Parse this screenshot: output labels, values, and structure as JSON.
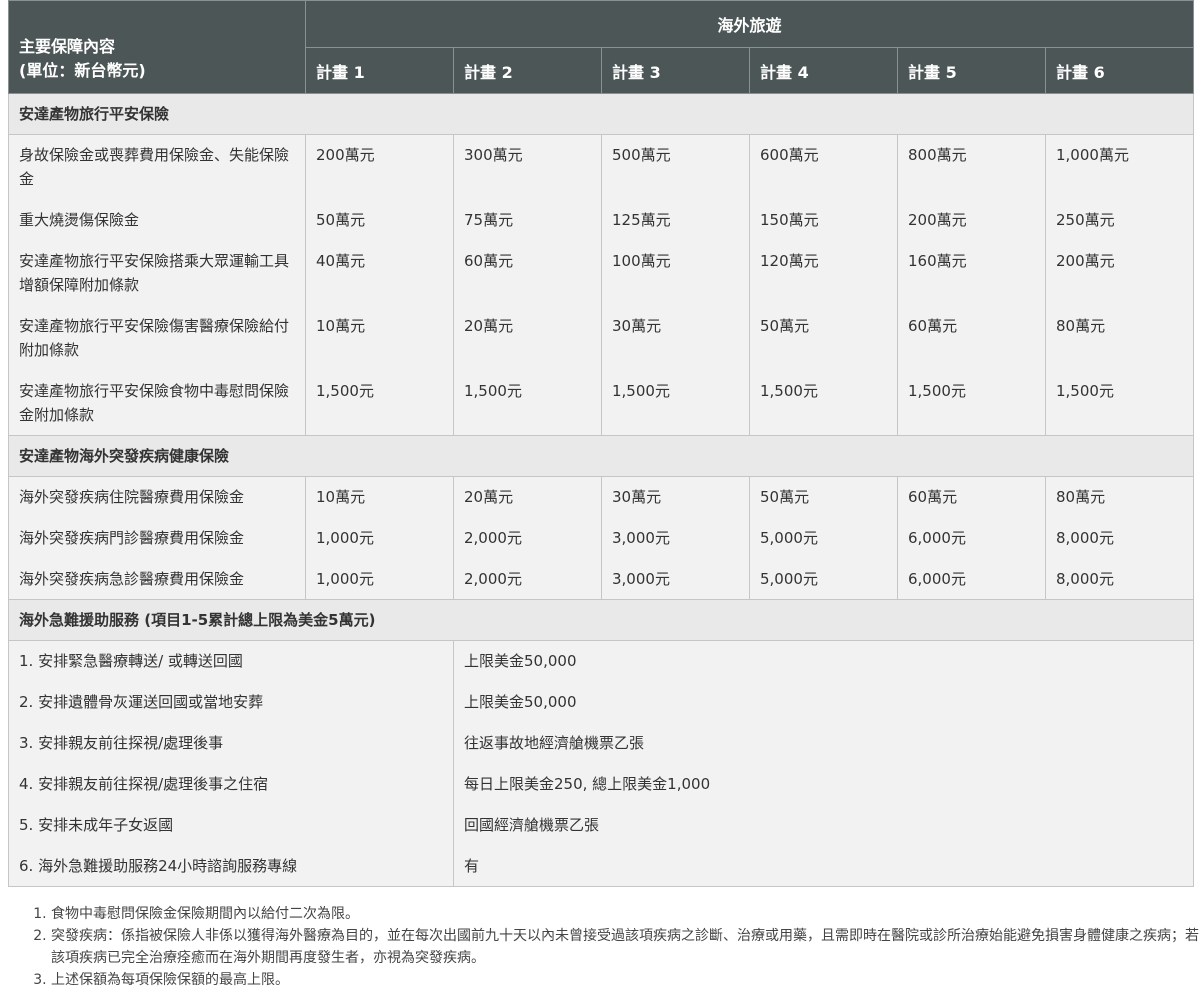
{
  "header": {
    "row_label_line1": "主要保障內容",
    "row_label_line2": "(單位：新台幣元)",
    "group_title": "海外旅遊",
    "plans": [
      "計畫 1",
      "計畫 2",
      "計畫 3",
      "計畫 4",
      "計畫 5",
      "計畫 6"
    ]
  },
  "sections": [
    {
      "title": "安達產物旅行平安保險",
      "rows": [
        {
          "label": "身故保險金或喪葬費用保險金、失能保險金",
          "values": [
            "200萬元",
            "300萬元",
            "500萬元",
            "600萬元",
            "800萬元",
            "1,000萬元"
          ]
        },
        {
          "label": "重大燒燙傷保險金",
          "values": [
            "50萬元",
            "75萬元",
            "125萬元",
            "150萬元",
            "200萬元",
            "250萬元"
          ]
        },
        {
          "label": "安達產物旅行平安保險搭乘大眾運輸工具增額保障附加條款",
          "values": [
            "40萬元",
            "60萬元",
            "100萬元",
            "120萬元",
            "160萬元",
            "200萬元"
          ]
        },
        {
          "label": "安達產物旅行平安保險傷害醫療保險給付附加條款",
          "values": [
            "10萬元",
            "20萬元",
            "30萬元",
            "50萬元",
            "60萬元",
            "80萬元"
          ]
        },
        {
          "label": "安達產物旅行平安保險食物中毒慰問保險金附加條款",
          "values": [
            "1,500元",
            "1,500元",
            "1,500元",
            "1,500元",
            "1,500元",
            "1,500元"
          ]
        }
      ]
    },
    {
      "title": "安達產物海外突發疾病健康保險",
      "rows": [
        {
          "label": "海外突發疾病住院醫療費用保險金",
          "values": [
            "10萬元",
            "20萬元",
            "30萬元",
            "50萬元",
            "60萬元",
            "80萬元"
          ]
        },
        {
          "label": "海外突發疾病門診醫療費用保險金",
          "values": [
            "1,000元",
            "2,000元",
            "3,000元",
            "5,000元",
            "6,000元",
            "8,000元"
          ]
        },
        {
          "label": "海外突發疾病急診醫療費用保險金",
          "values": [
            "1,000元",
            "2,000元",
            "3,000元",
            "5,000元",
            "6,000元",
            "8,000元"
          ]
        }
      ]
    }
  ],
  "assistance": {
    "title": "海外急難援助服務 (項目1-5累計總上限為美金5萬元)",
    "rows": [
      {
        "label": "1. 安排緊急醫療轉送/ 或轉送回國",
        "value": "上限美金50,000"
      },
      {
        "label": "2. 安排遺體骨灰運送回國或當地安葬",
        "value": "上限美金50,000"
      },
      {
        "label": "3. 安排親友前往探視/處理後事",
        "value": "往返事故地經濟艙機票乙張"
      },
      {
        "label": "4. 安排親友前往探視/處理後事之住宿",
        "value": "每日上限美金250, 總上限美金1,000"
      },
      {
        "label": "5. 安排未成年子女返國",
        "value": "回國經濟艙機票乙張"
      },
      {
        "label": "6. 海外急難援助服務24小時諮詢服務專線",
        "value": "有"
      }
    ]
  },
  "notes": [
    "食物中毒慰問保險金保險期間內以給付二次為限。",
    "突發疾病：係指被保險人非係以獲得海外醫療為目的，並在每次出國前九十天以內未曾接受過該項疾病之診斷、治療或用藥，且需即時在醫院或診所治療始能避免損害身體健康之疾病；若該項疾病已完全治療痊癒而在海外期間再度發生者，亦視為突發疾病。",
    "上述保額為每項保險保額的最高上限。"
  ]
}
